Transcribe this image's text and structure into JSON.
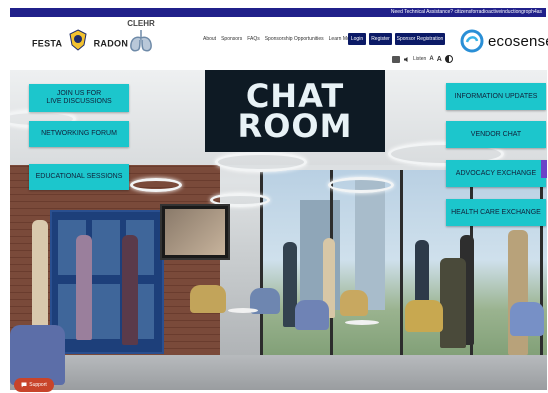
{
  "topbar": {
    "text": "Need Technical Assistance? citizensforradioactiveinductiongroph4as"
  },
  "logos": {
    "festa_left": "FESTA",
    "festa_right": "RADON",
    "clehr": "CLEHR",
    "ecosense": "ecosense"
  },
  "nav": {
    "items": [
      "About",
      "Sponsors",
      "FAQs",
      "Sponsorship Opportunities",
      "Learn More"
    ],
    "login": "Login",
    "register": "Register",
    "sponsor_registration": "Sponsor Registration"
  },
  "accessibility": {
    "label": "Listen"
  },
  "scene": {
    "sign_line1": "CHAT",
    "sign_line2": "ROOM"
  },
  "left_buttons": [
    {
      "label_line1": "JOIN US FOR",
      "label_line2": "LIVE DISCUSSIONS"
    },
    {
      "label_line1": "NETWORKING FORUM",
      "label_line2": ""
    },
    {
      "label_line1": "EDUCATIONAL SESSIONS",
      "label_line2": ""
    }
  ],
  "right_buttons": [
    {
      "label": "INFORMATION UPDATES"
    },
    {
      "label": "VENDOR CHAT"
    },
    {
      "label": "ADVOCACY EXCHANGE"
    },
    {
      "label": "HEALTH CARE EXCHANGE"
    }
  ],
  "support": {
    "label": "Support"
  },
  "colors": {
    "navy": "#20208a",
    "teal": "#1cc6cc",
    "support": "#c8442a",
    "eco_blue": "#2a8fd6"
  },
  "icons": [
    "festa-emblem-icon",
    "lungs-icon",
    "ecosense-logo-icon",
    "chat-bubble-icon",
    "speaker-icon"
  ]
}
